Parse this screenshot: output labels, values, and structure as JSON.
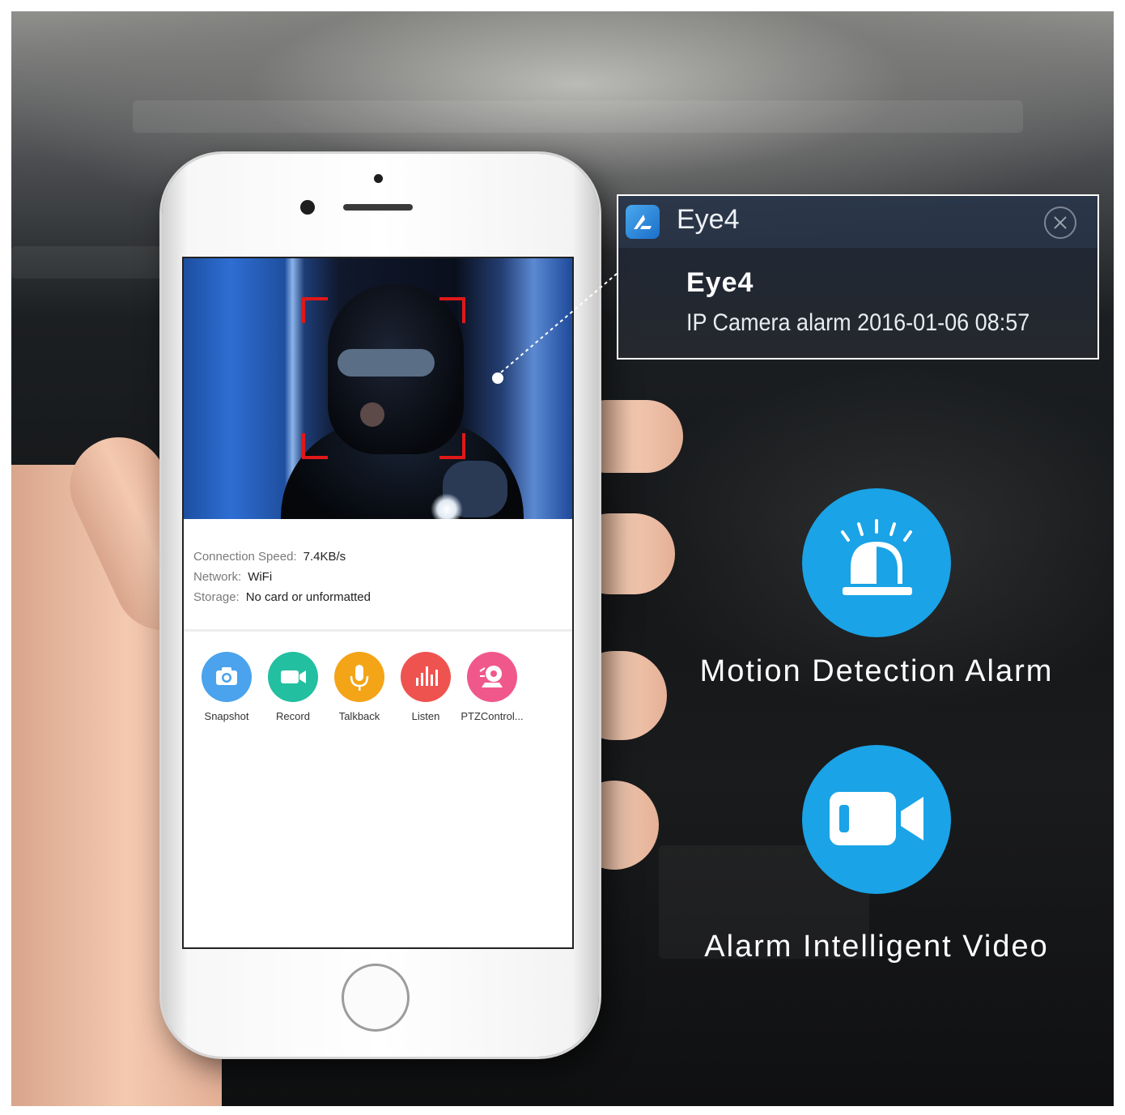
{
  "notification": {
    "app_name": "Eye4",
    "title": "Eye4",
    "message": "IP Camera alarm 2016-01-06 08:57"
  },
  "device_info": {
    "connection_speed_label": "Connection Speed:",
    "connection_speed_value": "7.4KB/s",
    "network_label": "Network:",
    "network_value": "WiFi",
    "storage_label": "Storage:",
    "storage_value": "No card or unformatted"
  },
  "actions": [
    {
      "label": "Snapshot",
      "icon": "camera-icon",
      "color": "#4aa3ec"
    },
    {
      "label": "Record",
      "icon": "video-camera-icon",
      "color": "#22bfa0"
    },
    {
      "label": "Talkback",
      "icon": "microphone-icon",
      "color": "#f4a417"
    },
    {
      "label": "Listen",
      "icon": "audio-bars-icon",
      "color": "#ef5350"
    },
    {
      "label": "PTZControl...",
      "icon": "ptz-camera-icon",
      "color": "#f0588c"
    }
  ],
  "features": [
    {
      "label": "Motion Detection Alarm",
      "icon": "siren-icon"
    },
    {
      "label": "Alarm Intelligent Video",
      "icon": "video-camera-icon"
    }
  ],
  "colors": {
    "feature_blue": "#1aa3e6",
    "detection_frame": "#e01818"
  }
}
